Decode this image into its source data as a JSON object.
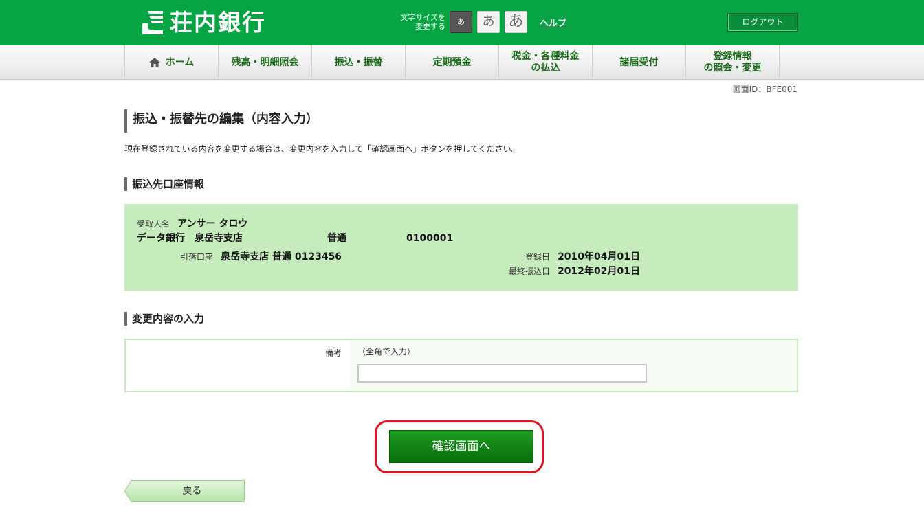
{
  "header": {
    "bank_name": "荘内銀行",
    "fontsize_label_line1": "文字サイズを",
    "fontsize_label_line2": "変更する",
    "fontsize_small": "あ",
    "fontsize_medium": "あ",
    "fontsize_large": "あ",
    "help_label": "ヘルプ",
    "logout_label": "ログアウト",
    "brand_color": "#07a444"
  },
  "nav": {
    "home": "ホーム",
    "balance": "残高・明細照会",
    "transfer": "振込・振替",
    "time_deposit": "定期預金",
    "tax_line1": "税金・各種料金",
    "tax_line2": "の払込",
    "notifications": "諸届受付",
    "registration_line1": "登録情報",
    "registration_line2": "の照会・変更"
  },
  "screen_id": "画面ID：BFE001",
  "page_title": "振込・振替先の編集（内容入力）",
  "instructions": "現在登録されている内容を変更する場合は、変更内容を入力して「確認画面へ」ボタンを押してください。",
  "account_section": {
    "title": "振込先口座情報",
    "recipient_label": "受取人名",
    "recipient_name": "アンサー タロウ",
    "bank_branch": "データ銀行　泉岳寺支店",
    "account_type": "普通",
    "account_number": "0100001",
    "debit_label": "引落口座",
    "debit_account": "泉岳寺支店 普通 0123456",
    "registered_label": "登録日",
    "registered_date": "2010年04月01日",
    "last_transfer_label": "最終振込日",
    "last_transfer_date": "2012年02月01日"
  },
  "input_section": {
    "title": "変更内容の入力",
    "memo_label": "備考",
    "memo_hint": "（全角で入力）",
    "memo_value": ""
  },
  "buttons": {
    "confirm": "確認画面へ",
    "back": "戻る"
  }
}
